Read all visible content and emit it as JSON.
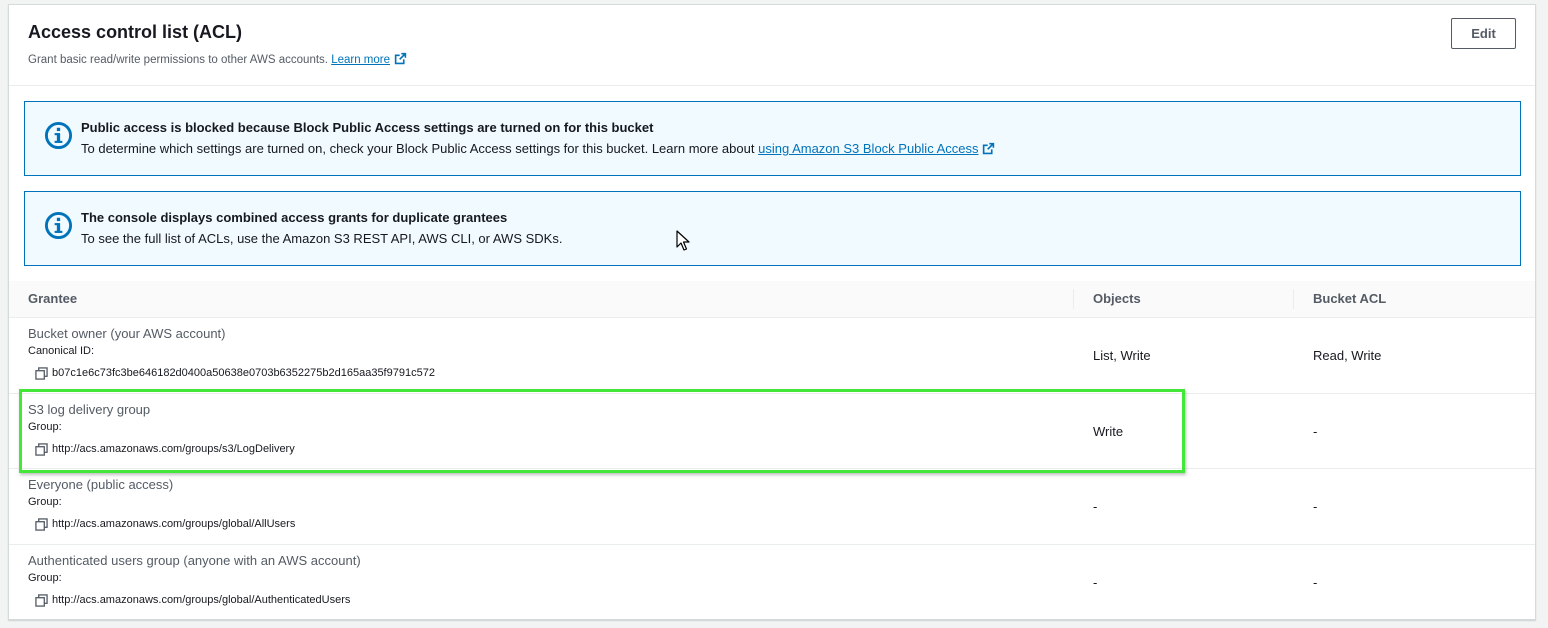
{
  "header": {
    "title": "Access control list (ACL)",
    "description": "Grant basic read/write permissions to other AWS accounts.",
    "learn_more": "Learn more",
    "edit_label": "Edit"
  },
  "alerts": [
    {
      "title": "Public access is blocked because Block Public Access settings are turned on for this bucket",
      "body": "To determine which settings are turned on, check your Block Public Access settings for this bucket. Learn more about",
      "link": "using Amazon S3 Block Public Access"
    },
    {
      "title": "The console displays combined access grants for duplicate grantees",
      "body": "To see the full list of ACLs, use the Amazon S3 REST API, AWS CLI, or AWS SDKs."
    }
  ],
  "table": {
    "columns": [
      "Grantee",
      "Objects",
      "Bucket ACL"
    ],
    "rows": [
      {
        "name": "Bucket owner (your AWS account)",
        "id_label": "Canonical ID:",
        "id_value": "b07c1e6c73fc3be646182d0400a50638e0703b6352275b2d165aa35f9791c572",
        "objects": "List, Write",
        "bucket_acl": "Read, Write"
      },
      {
        "name": "S3 log delivery group",
        "id_label": "Group:",
        "id_value": "http://acs.amazonaws.com/groups/s3/LogDelivery",
        "objects": "Write",
        "bucket_acl": "-"
      },
      {
        "name": "Everyone (public access)",
        "id_label": "Group:",
        "id_value": "http://acs.amazonaws.com/groups/global/AllUsers",
        "objects": "-",
        "bucket_acl": "-"
      },
      {
        "name": "Authenticated users group (anyone with an AWS account)",
        "id_label": "Group:",
        "id_value": "http://acs.amazonaws.com/groups/global/AuthenticatedUsers",
        "objects": "-",
        "bucket_acl": "-"
      }
    ]
  },
  "icons": {
    "info": "info-circle-icon",
    "external": "external-link-icon",
    "copy": "copy-icon",
    "cursor": "mouse-pointer-icon"
  },
  "colors": {
    "accent": "#0073bb",
    "highlight": "#44e63a",
    "alert_bg": "#f1faff"
  }
}
